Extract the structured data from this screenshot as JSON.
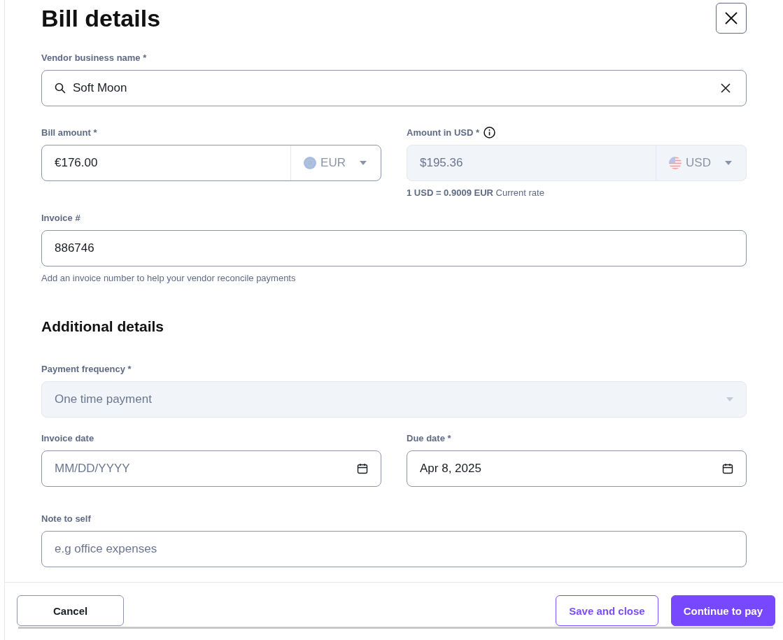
{
  "title": "Bill details",
  "fields": [
    {
      "kind": "search",
      "label": "Vendor business name *",
      "value": "Soft Moon",
      "disabled": false
    },
    {
      "kind": "amount_pair",
      "items": [
        {
          "label": "Bill amount *",
          "value": "€176.00",
          "currency": "EUR",
          "disabled": false
        },
        {
          "label": "Amount in USD *",
          "value": "$195.36",
          "currency": "USD",
          "disabled": true,
          "info": true,
          "hint": "**1 USD = 0.9009 EUR** Current rate"
        }
      ]
    },
    {
      "kind": "text",
      "label": "Invoice #",
      "value": "886746",
      "disabled": false,
      "hint": "Add an invoice number to help your vendor reconcile payments"
    },
    {
      "kind": "heading",
      "text": "Additional details"
    },
    {
      "kind": "select",
      "label": "Payment frequency *",
      "value": "One time payment",
      "disabled": true
    },
    {
      "kind": "date_pair",
      "items": [
        {
          "label": "Invoice date",
          "placeholder": "MM/DD/YYYY",
          "disabled": false
        },
        {
          "label": "Due date *",
          "value": "Apr 8, 2025",
          "disabled": false
        }
      ]
    },
    {
      "kind": "text",
      "label": "Note to self",
      "placeholder": "e.g office expenses",
      "disabled": false
    }
  ],
  "buttons": [
    {
      "label": "Cancel",
      "kind": "secondary"
    },
    {
      "label": "Save and close",
      "kind": "outline"
    },
    {
      "label": "Continue to pay",
      "kind": "primary"
    }
  ]
}
